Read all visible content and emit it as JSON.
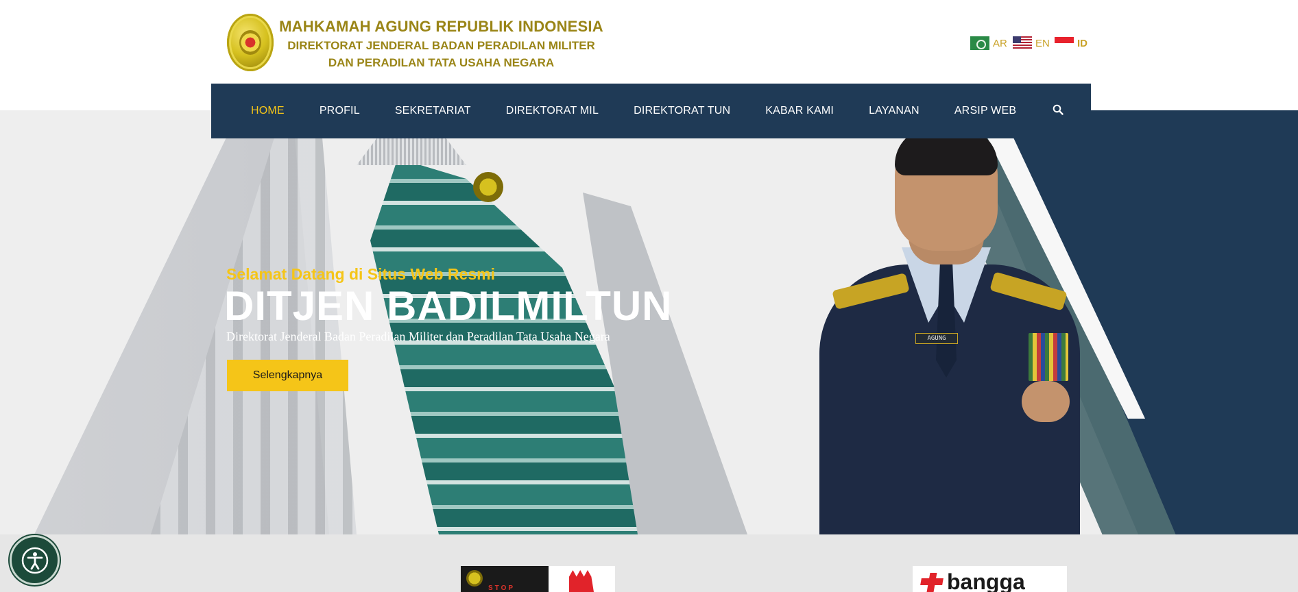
{
  "header": {
    "logo_line1": "MAHKAMAH AGUNG REPUBLIK INDONESIA",
    "logo_line2": "DIREKTORAT JENDERAL BADAN PERADILAN MILITER",
    "logo_line3": "DAN PERADILAN TATA USAHA NEGARA",
    "languages": [
      {
        "code": "AR",
        "flag": "flag-ar-icon",
        "active": false
      },
      {
        "code": "EN",
        "flag": "flag-us-icon",
        "active": false
      },
      {
        "code": "ID",
        "flag": "flag-id-icon",
        "active": true
      }
    ]
  },
  "nav": {
    "items": [
      {
        "label": "HOME",
        "active": true
      },
      {
        "label": "PROFIL",
        "active": false
      },
      {
        "label": "SEKRETARIAT",
        "active": false
      },
      {
        "label": "DIREKTORAT MIL",
        "active": false
      },
      {
        "label": "DIREKTORAT TUN",
        "active": false
      },
      {
        "label": "KABAR KAMI",
        "active": false
      },
      {
        "label": "LAYANAN",
        "active": false
      },
      {
        "label": "ARSIP WEB",
        "active": false
      }
    ],
    "search_icon": "search-icon"
  },
  "hero": {
    "welcome": "Selamat Datang di Situs Web Resmi",
    "title": "DITJEN BADILMILTUN",
    "subtitle": "Direktorat Jenderal Badan Peradilan Militer dan Peradilan Tata Usaha Negara",
    "button_label": "Selengkapnya",
    "officer_nametag": "AGUNG"
  },
  "banners": {
    "left_text": "STOP",
    "right_text": "bangga"
  },
  "colors": {
    "navy": "#1f3a56",
    "gold": "#f5c518",
    "logo_gold": "#9a8517",
    "lang_gold": "#c9a227",
    "accessibility_green": "#1c4a3a"
  }
}
